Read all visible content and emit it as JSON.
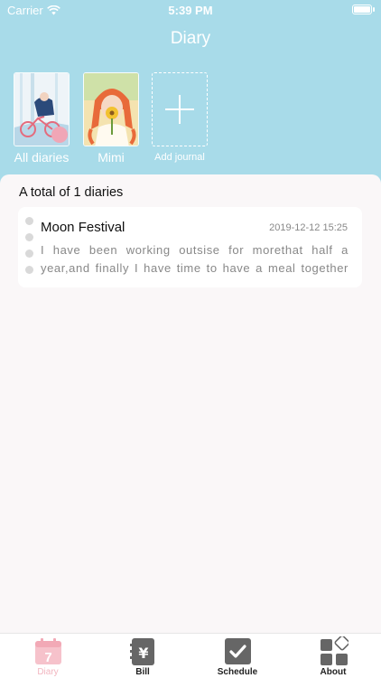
{
  "status_bar": {
    "carrier": "Carrier",
    "time": "5:39 PM"
  },
  "header": {
    "title": "Diary"
  },
  "journals": [
    {
      "label": "All diaries",
      "icon": "all-diaries-cover"
    },
    {
      "label": "Mimi",
      "icon": "mimi-cover"
    },
    {
      "label": "Add journal",
      "icon": "plus-icon"
    }
  ],
  "summary": {
    "total_text": "A total of 1 diaries"
  },
  "diaries": [
    {
      "title": "Moon Festival",
      "date": "2019-12-12 15:25",
      "excerpt": "I have been working outsise for morethat half a year,and finally I have time to have a meal together"
    }
  ],
  "tabs": [
    {
      "label": "Diary",
      "icon": "calendar-7-icon",
      "active": true
    },
    {
      "label": "Bill",
      "icon": "yen-icon",
      "active": false
    },
    {
      "label": "Schedule",
      "icon": "checkbox-icon",
      "active": false
    },
    {
      "label": "About",
      "icon": "grid-icon",
      "active": false
    }
  ],
  "colors": {
    "header_bg": "#a8dbe9",
    "accent_pink": "#f2b6c0",
    "tab_gray": "#666666"
  }
}
